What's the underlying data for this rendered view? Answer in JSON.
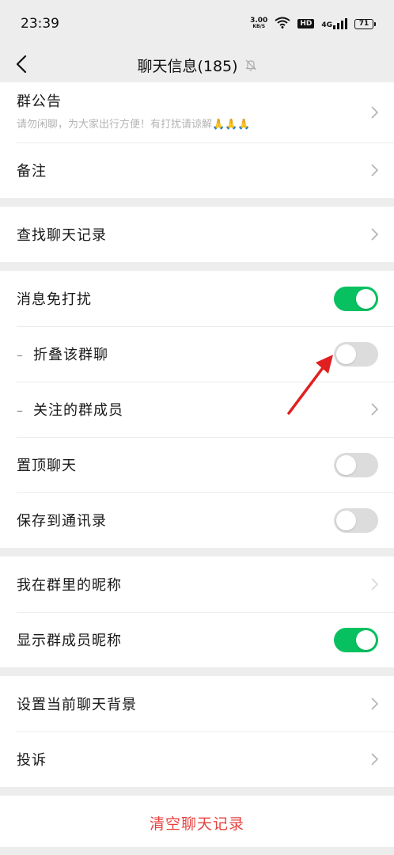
{
  "status_bar": {
    "time": "23:39",
    "speed_value": "3.00",
    "speed_unit": "KB/S",
    "hd_label": "HD",
    "network": "4G",
    "battery": "71"
  },
  "nav": {
    "title": "聊天信息(185)",
    "back_icon": "chevron-left-icon",
    "mute_icon": "bell-off-icon"
  },
  "sections": {
    "notice": {
      "title": "群公告",
      "text": "请勿闲聊，为大家出行方便！有打扰请谅解🙏🙏🙏"
    },
    "remark": "备注",
    "search_history": "查找聊天记录",
    "mute": "消息免打扰",
    "fold_group": "折叠该群聊",
    "follow_members": "关注的群成员",
    "pin_chat": "置顶聊天",
    "save_contacts": "保存到通讯录",
    "my_nickname": "我在群里的昵称",
    "show_nicknames": "显示群成员昵称",
    "set_background": "设置当前聊天背景",
    "complaint": "投诉",
    "clear_history": "清空聊天记录"
  },
  "toggles": {
    "mute": true,
    "fold_group": false,
    "pin_chat": false,
    "save_contacts": false,
    "show_nicknames": true
  },
  "colors": {
    "toggle_on": "#07c160",
    "toggle_off": "#dcdcdc",
    "danger": "#e64340",
    "annotation_arrow": "#e02020"
  }
}
